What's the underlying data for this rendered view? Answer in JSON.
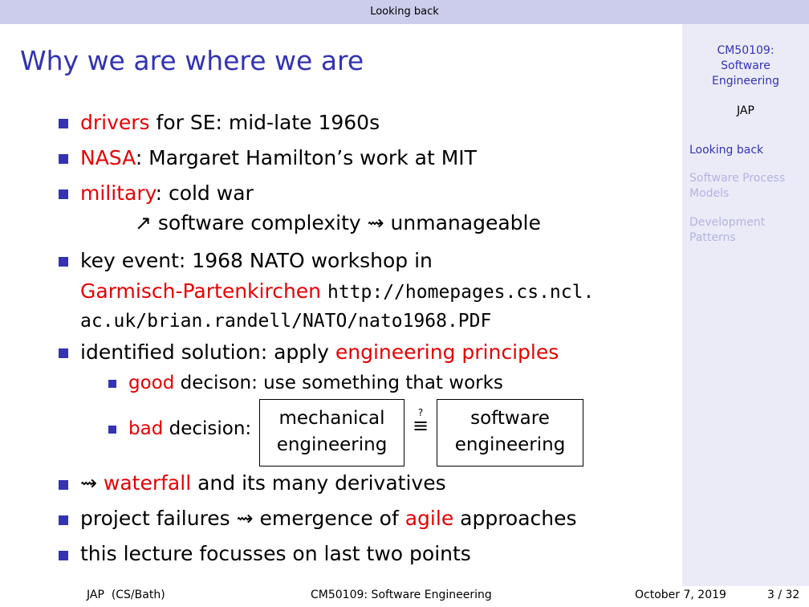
{
  "header": {
    "section": "Looking back"
  },
  "sidebar": {
    "course_line1": "CM50109:",
    "course_line2": "Software",
    "course_line3": "Engineering",
    "author": "JAP",
    "sections": [
      {
        "line1": "Looking back",
        "line2": ""
      },
      {
        "line1": "Software Process",
        "line2": "Models"
      },
      {
        "line1": "Development",
        "line2": "Patterns"
      }
    ]
  },
  "slide": {
    "title": "Why we are where we are",
    "b1": {
      "hl": "drivers",
      "rest": " for SE: mid-late 1960s"
    },
    "b2": {
      "hl": "NASA",
      "rest": ": Margaret Hamilton’s work at MIT"
    },
    "b3": {
      "hl": "military",
      "rest": ": cold war",
      "sub_arrow": "↗",
      "sub_a": " software complexity ",
      "sub_sq": "⇝",
      "sub_b": " unmanageable"
    },
    "b4": {
      "line1": "key event: 1968 NATO workshop in",
      "hl": "Garmisch-Partenkirchen",
      "url1": "http://homepages.cs.ncl.",
      "url2": "ac.uk/brian.randell/NATO/nato1968.PDF"
    },
    "b5": {
      "pre": "identified solution: apply ",
      "hl": "engineering principles"
    },
    "b5a": {
      "hl": "good",
      "rest": " decison: use something that works"
    },
    "b5b": {
      "hl": "bad",
      "rest": " decision:",
      "box1_line1": "mechanical",
      "box1_line2": "engineering",
      "question": "?",
      "equiv": "≡",
      "box2_line1": "software",
      "box2_line2": "engineering"
    },
    "b6": {
      "sq": "⇝",
      "hl": "waterfall",
      "rest": " and its many derivatives"
    },
    "b7": {
      "pre": "project failures ",
      "sq": "⇝",
      "mid": " emergence of ",
      "hl": "agile",
      "rest": " approaches"
    },
    "b8": {
      "text": "this lecture focusses on last two points"
    }
  },
  "footer": {
    "author": "JAP",
    "institution": "(CS/Bath)",
    "course": "CM50109: Software Engineering",
    "date": "October 7, 2019",
    "page": "3 / 32"
  },
  "colors": {
    "theme": "#3333b3",
    "highlight": "#e60000",
    "header_bg": "#ccccec",
    "sidebar_bg": "#ebebf7"
  }
}
